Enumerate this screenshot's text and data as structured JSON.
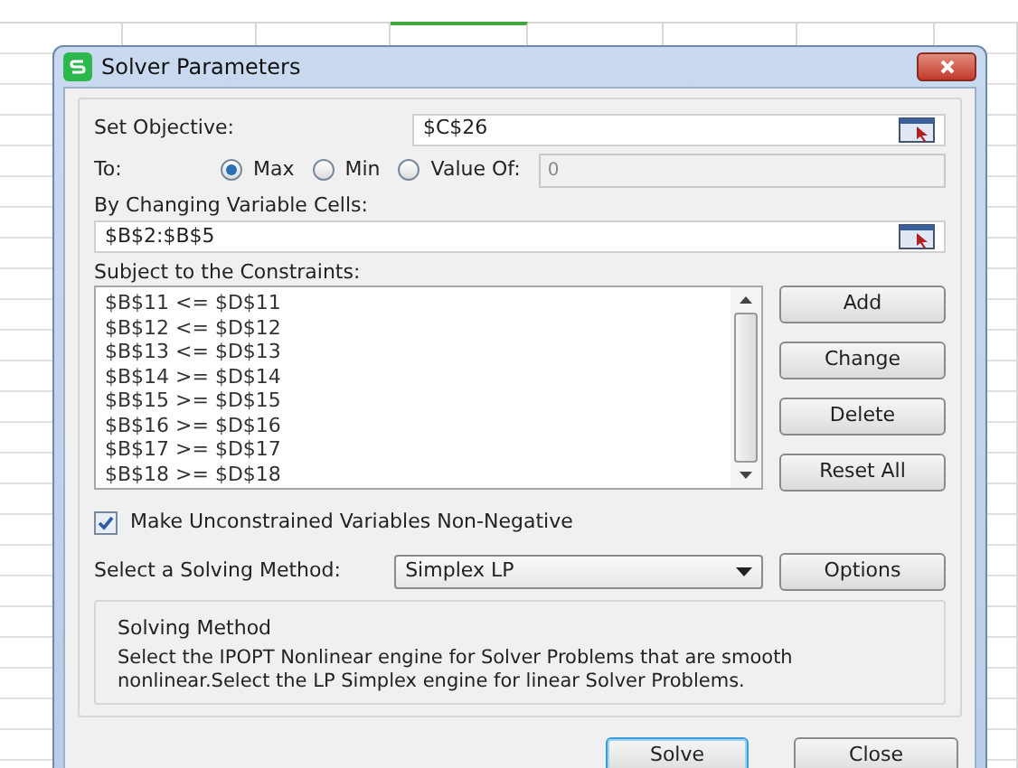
{
  "window": {
    "title": "Solver Parameters"
  },
  "objective": {
    "label": "Set Objective:",
    "value": "$C$26"
  },
  "to": {
    "label": "To:",
    "options": [
      {
        "label": "Max",
        "selected": true
      },
      {
        "label": "Min",
        "selected": false
      },
      {
        "label": "Value Of:",
        "selected": false
      }
    ],
    "value_field": {
      "value": "0",
      "disabled": true
    }
  },
  "variable_cells": {
    "label": "By Changing Variable Cells:",
    "value": "$B$2:$B$5"
  },
  "constraints": {
    "label": "Subject to the Constraints:",
    "items": [
      "$B$11 <= $D$11",
      "$B$12 <= $D$12",
      "$B$13 <= $D$13",
      "$B$14 >= $D$14",
      "$B$15 >= $D$15",
      "$B$16 >= $D$16",
      "$B$17 >= $D$17",
      "$B$18 >= $D$18"
    ],
    "buttons": [
      "Add",
      "Change",
      "Delete",
      "Reset All"
    ]
  },
  "non_negative": {
    "label": "Make Unconstrained Variables Non-Negative",
    "checked": true
  },
  "method": {
    "label": "Select a Solving Method:",
    "value": "Simplex LP",
    "options_button": "Options"
  },
  "description": {
    "title": "Solving Method",
    "text": "Select the IPOPT Nonlinear engine for Solver Problems that are smooth nonlinear.Select the LP Simplex engine for linear Solver Problems."
  },
  "footer_buttons": [
    {
      "label": "Solve",
      "selected": true
    },
    {
      "label": "Close",
      "selected": false
    }
  ]
}
